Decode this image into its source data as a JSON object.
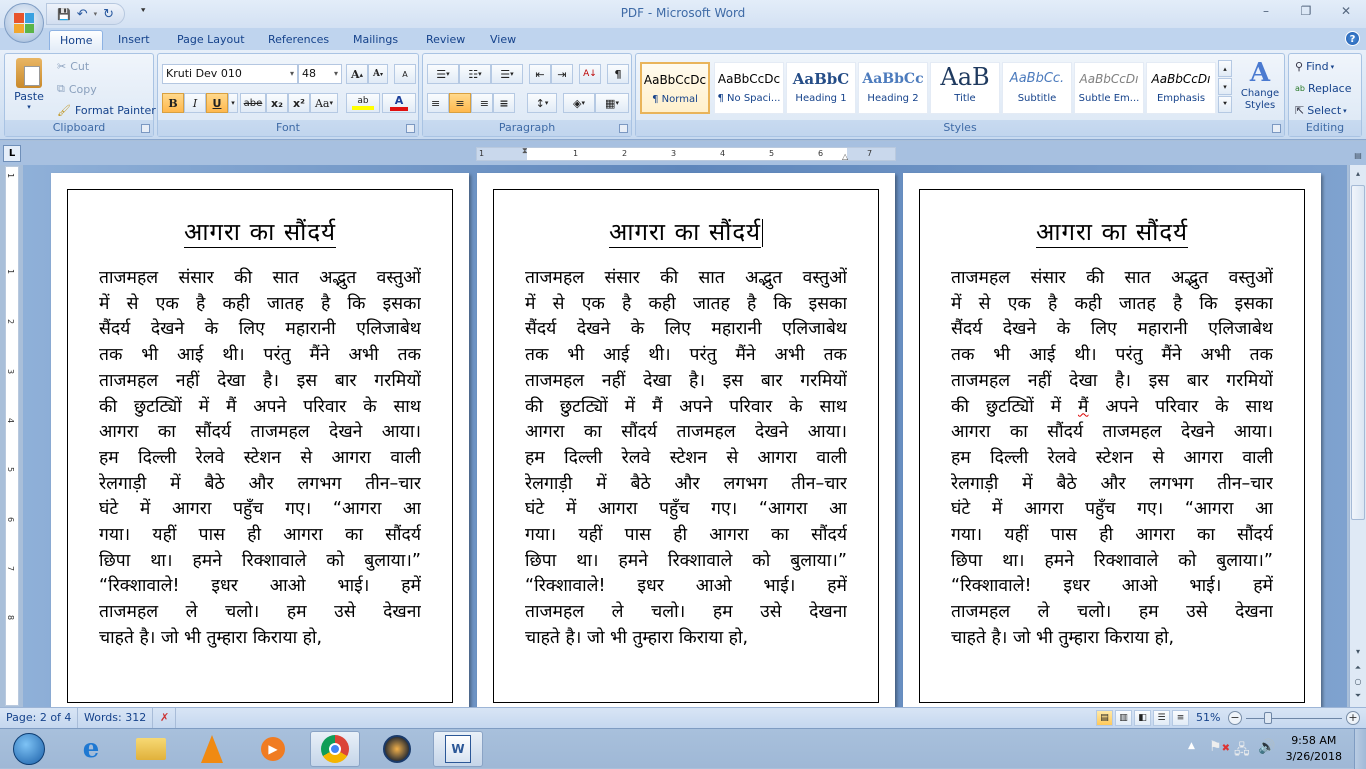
{
  "window": {
    "title": "PDF - Microsoft Word",
    "controls": {
      "minimize": "–",
      "restore": "❐",
      "close": "✕"
    }
  },
  "quick_access": {
    "save_icon": "💾",
    "undo_icon": "↶",
    "redo_icon": "↻",
    "more_icon": "⯆"
  },
  "tabs": [
    {
      "label": "Home",
      "active": true
    },
    {
      "label": "Insert"
    },
    {
      "label": "Page Layout"
    },
    {
      "label": "References"
    },
    {
      "label": "Mailings"
    },
    {
      "label": "Review"
    },
    {
      "label": "View"
    }
  ],
  "help_icon": "?",
  "ribbon": {
    "clipboard": {
      "label": "Clipboard",
      "paste": "Paste",
      "cut": "Cut",
      "copy": "Copy",
      "format_painter": "Format Painter"
    },
    "font": {
      "label": "Font",
      "font_name": "Kruti Dev 010",
      "font_size": "48",
      "grow": "A",
      "shrink": "A",
      "clear": "A",
      "bold": "B",
      "italic": "I",
      "underline": "U",
      "strike": "abe",
      "subscript": "x₂",
      "superscript": "x²",
      "change_case": "Aa",
      "highlight": "ab",
      "font_color": "A",
      "highlight_color": "#ffff00",
      "font_color_value": "#e01010"
    },
    "paragraph": {
      "label": "Paragraph",
      "bullets": "☰",
      "numbering": "☷",
      "multilevel": "☰",
      "dec_indent": "⇤",
      "inc_indent": "⇥",
      "sort": "A↓",
      "show_marks": "¶",
      "align_left": "≡",
      "align_center": "≡",
      "align_right": "≡",
      "justify": "≡",
      "line_spacing": "↕",
      "shading": "◈",
      "borders": "▦"
    },
    "styles": {
      "label": "Styles",
      "items": [
        {
          "sample": "AaBbCcDc",
          "name": "¶ Normal",
          "selected": true
        },
        {
          "sample": "AaBbCcDc",
          "name": "¶ No Spaci..."
        },
        {
          "sample": "AaBbC",
          "name": "Heading 1"
        },
        {
          "sample": "AaBbCc",
          "name": "Heading 2"
        },
        {
          "sample": "AaB",
          "name": "Title"
        },
        {
          "sample": "AaBbCc.",
          "name": "Subtitle"
        },
        {
          "sample": "AaBbCcDı",
          "name": "Subtle Em..."
        },
        {
          "sample": "AaBbCcDı",
          "name": "Emphasis"
        }
      ],
      "change_styles": "Change Styles"
    },
    "editing": {
      "label": "Editing",
      "find": "Find",
      "replace": "Replace",
      "select": "Select"
    }
  },
  "ruler": {
    "tab_selector": "L",
    "h_numbers": [
      "1",
      "1",
      "2",
      "3",
      "4",
      "5",
      "6",
      "7"
    ],
    "v_numbers": [
      "1",
      "1",
      "2",
      "3",
      "4",
      "5",
      "6",
      "7",
      "8"
    ]
  },
  "document": {
    "title": "आगरा का सौंदर्य",
    "lines": [
      "ताजमहल संसार की सात अद्भुत वस्तुओं",
      "में से एक है कही जातह है कि इसका",
      "सैंदर्य देखने के लिए महारानी एलिजाबेथ",
      "तक भी आई थी। परंतु मैंने अभी तक",
      "ताजमहल नहीं देखा है। इस बार गरमियों",
      "की छुटट्यिों में मैं अपने परिवार के साथ",
      "आगरा का सौंदर्य ताजमहल देखने आया।",
      "हम दिल्ली रेलवे स्टेशन से  आगरा वाली",
      "रेलगाड़ी में बैठे और लगभग तीन–चार",
      "घंटे में  आगरा पहुँच गए। “आगरा आ",
      "गया। यहीं पास ही आगरा का सौंदर्य",
      "छिपा था। हमने रिक्शावाले को बुलाया।”",
      "“रिक्शावाले! इधर आओ भाई। हमें",
      "ताजमहल ले चलो। हम उसे देखना",
      "चाहते है। जो भी तुम्हारा किराया हो,"
    ]
  },
  "statusbar": {
    "page": "Page: 2 of 4",
    "words": "Words: 312",
    "proofing_icon": "✗",
    "zoom": "51%",
    "zoom_level_percent": 51,
    "view_icons": [
      "print-layout",
      "full-screen-reading",
      "web-layout",
      "outline",
      "draft"
    ]
  },
  "taskbar": {
    "apps": [
      "start",
      "internet-explorer",
      "file-explorer",
      "vlc",
      "media-player",
      "chrome",
      "media-center",
      "word"
    ],
    "clock_time": "9:58 AM",
    "clock_date": "3/26/2018"
  }
}
